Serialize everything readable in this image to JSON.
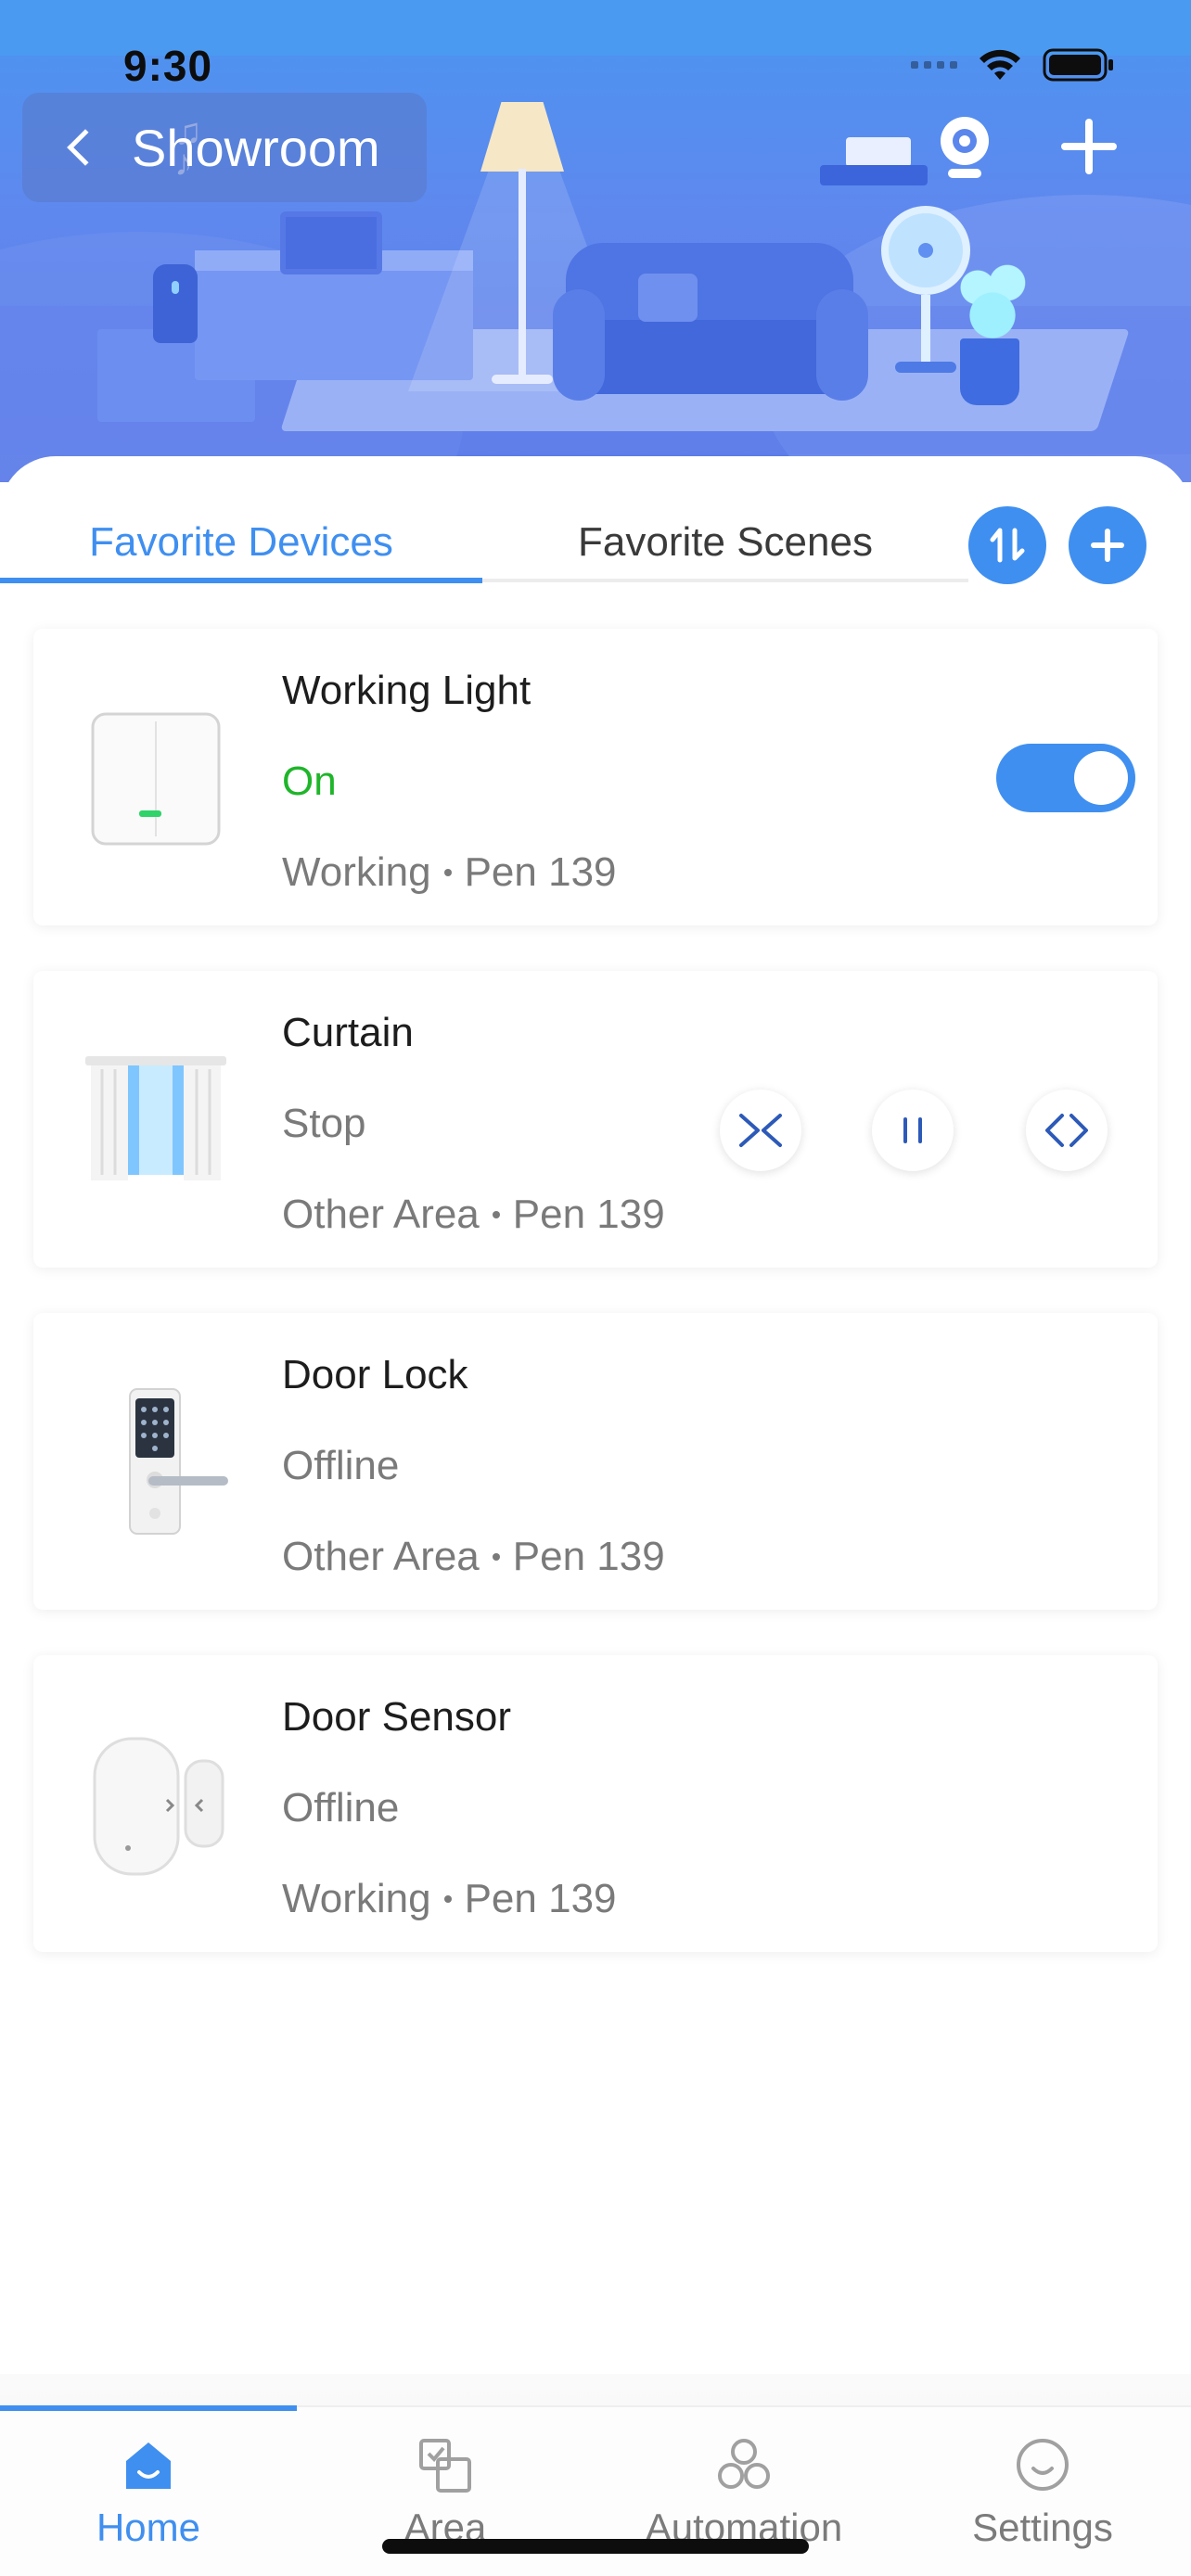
{
  "status_bar": {
    "time": "9:30",
    "icons": [
      "signal-icon",
      "wifi-icon",
      "battery-icon"
    ]
  },
  "header": {
    "room_name": "Showroom",
    "actions": [
      "camera-icon",
      "add-icon"
    ]
  },
  "tabs": [
    {
      "label": "Favorite Devices",
      "active": true
    },
    {
      "label": "Favorite Scenes",
      "active": false
    }
  ],
  "tab_actions": [
    "sort-icon",
    "plus-icon"
  ],
  "devices": [
    {
      "name": "Working Light",
      "state": "On",
      "area": "Working",
      "location": "Pen 139",
      "toggle_on": true
    },
    {
      "name": "Curtain",
      "state": "Stop",
      "area": "Other Area",
      "location": "Pen 139",
      "controls": [
        "close-curtain-icon",
        "pause-icon",
        "open-curtain-icon"
      ]
    },
    {
      "name": "Door Lock",
      "state": "Offline",
      "area": "Other Area",
      "location": "Pen 139"
    },
    {
      "name": "Door Sensor",
      "state": "Offline",
      "area": "Working",
      "location": "Pen 139"
    }
  ],
  "nav": [
    {
      "label": "Home",
      "icon": "home-icon",
      "active": true
    },
    {
      "label": "Area",
      "icon": "area-icon",
      "active": false
    },
    {
      "label": "Automation",
      "icon": "automation-icon",
      "active": false
    },
    {
      "label": "Settings",
      "icon": "settings-icon",
      "active": false
    }
  ],
  "colors": {
    "accent": "#3f8ff0",
    "on_state": "#1fb52a",
    "muted": "#7a7a7a"
  }
}
